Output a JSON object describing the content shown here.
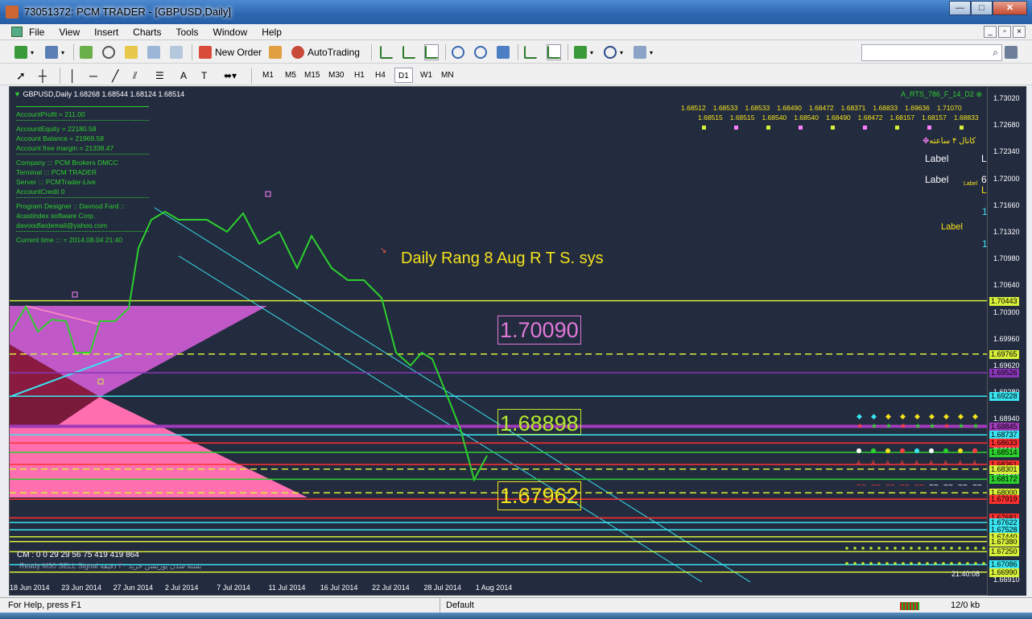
{
  "window": {
    "title": "73051372: PCM TRADER - [GBPUSD,Daily]",
    "min": "—",
    "max": "□",
    "close": "✕"
  },
  "menu": [
    "File",
    "View",
    "Insert",
    "Charts",
    "Tools",
    "Window",
    "Help"
  ],
  "toolbar": {
    "new_order": "New Order",
    "autotrading": "AutoTrading"
  },
  "timeframes": [
    "M1",
    "M5",
    "M15",
    "M30",
    "H1",
    "H4",
    "D1",
    "W1",
    "MN"
  ],
  "active_timeframe": "D1",
  "chart": {
    "symbol_header": "GBPUSD,Daily  1.68268 1.68544 1.68124 1.68514",
    "indicator_name": "A_RTS_786_F_14_D2",
    "account_info": [
      "AccountProfit = 211.00",
      "AccountEquity      = 22180.58",
      "Account Balance    = 21969.58",
      "Account free margin = 21338.47",
      "Company  ::: PCM Brokers DMCC",
      "Terminal ::: PCM TRADER",
      "Server   ::: PCMTrader-Live",
      "AccountCredit 0",
      "Program Designer :: Davood Fard ::",
      "4castindex software  Corp.",
      "davoodfardemail@yahoo.com",
      "Current time ::: = 2014.08.04 21:40"
    ],
    "headline": "Daily Rang  8  Aug   R T S.  sys",
    "level_high": "1.70090",
    "level_mid": "1.68898",
    "level_low": "1.67962",
    "top_row_1": [
      "1.68512",
      "1.68533",
      "1.68533",
      "1.68490",
      "1.68472",
      "1.68371",
      "1.68833",
      "1.69636",
      "1.71070"
    ],
    "top_row_2": [
      "1.68515",
      "1.68515",
      "1.68540",
      "1.68540",
      "1.68490",
      "1.68472",
      "1.68157",
      "1.68157",
      "1.68833"
    ],
    "persian_label": "کانال ۴ ساعته",
    "label1": "Label",
    "label2": "Label",
    "label3": "Label",
    "label4": "Label",
    "side_chars": [
      "La",
      "6",
      "La",
      "1",
      "1"
    ],
    "cm_line": "CM : 0  0  29  29  56  75  419  419  864",
    "ready_line": "Ready  M30 SELL Signal  بسته شدن پوزیشن خرید ۳۰ دقیقه",
    "clock": "21:40:08"
  },
  "price_scale": [
    "1.73020",
    "1.72680",
    "1.72340",
    "1.72000",
    "1.71660",
    "1.71320",
    "1.70980",
    "1.70640",
    "1.70300",
    "1.69960",
    "1.69620",
    "1.69280",
    "1.68940",
    "1.68600",
    "1.68260",
    "1.67920",
    "1.67580",
    "1.67240",
    "1.66910"
  ],
  "price_tags": [
    {
      "v": "1.70443",
      "c": "#d7f03a"
    },
    {
      "v": "1.69765",
      "c": "#d7f03a"
    },
    {
      "v": "1.69526",
      "c": "#8a36b8"
    },
    {
      "v": "1.69228",
      "c": "#39e5f0"
    },
    {
      "v": "1.68845",
      "c": "#a03ab8"
    },
    {
      "v": "1.68737",
      "c": "#39e5f0"
    },
    {
      "v": "1.68633",
      "c": "#ff3030"
    },
    {
      "v": "1.68514",
      "c": "#2dd02d"
    },
    {
      "v": "1.68361",
      "c": "#ff3030"
    },
    {
      "v": "1.68301",
      "c": "#d7f03a"
    },
    {
      "v": "1.68172",
      "c": "#2dd02d"
    },
    {
      "v": "1.68000",
      "c": "#d7f03a"
    },
    {
      "v": "1.67919",
      "c": "#ff3030"
    },
    {
      "v": "1.67681",
      "c": "#ff3030"
    },
    {
      "v": "1.67622",
      "c": "#39e5f0"
    },
    {
      "v": "1.67528",
      "c": "#39e5f0"
    },
    {
      "v": "1.67440",
      "c": "#d7f03a"
    },
    {
      "v": "1.67380",
      "c": "#d7f03a"
    },
    {
      "v": "1.67250",
      "c": "#d7f03a"
    },
    {
      "v": "1.67086",
      "c": "#39e5f0"
    },
    {
      "v": "1.66990",
      "c": "#d7f03a"
    }
  ],
  "dates": [
    "18 Jun 2014",
    "23 Jun 2014",
    "27 Jun 2014",
    "2 Jul 2014",
    "7 Jul 2014",
    "11 Jul 2014",
    "16 Jul 2014",
    "22 Jul 2014",
    "28 Jul 2014",
    "1 Aug 2014"
  ],
  "status": {
    "help": "For Help, press F1",
    "profile": "Default",
    "traffic": "12/0 kb"
  },
  "colors": {
    "chart_bg": "#232b3f",
    "price_line": "#2dd02d",
    "yellow": "#f5e31c"
  }
}
